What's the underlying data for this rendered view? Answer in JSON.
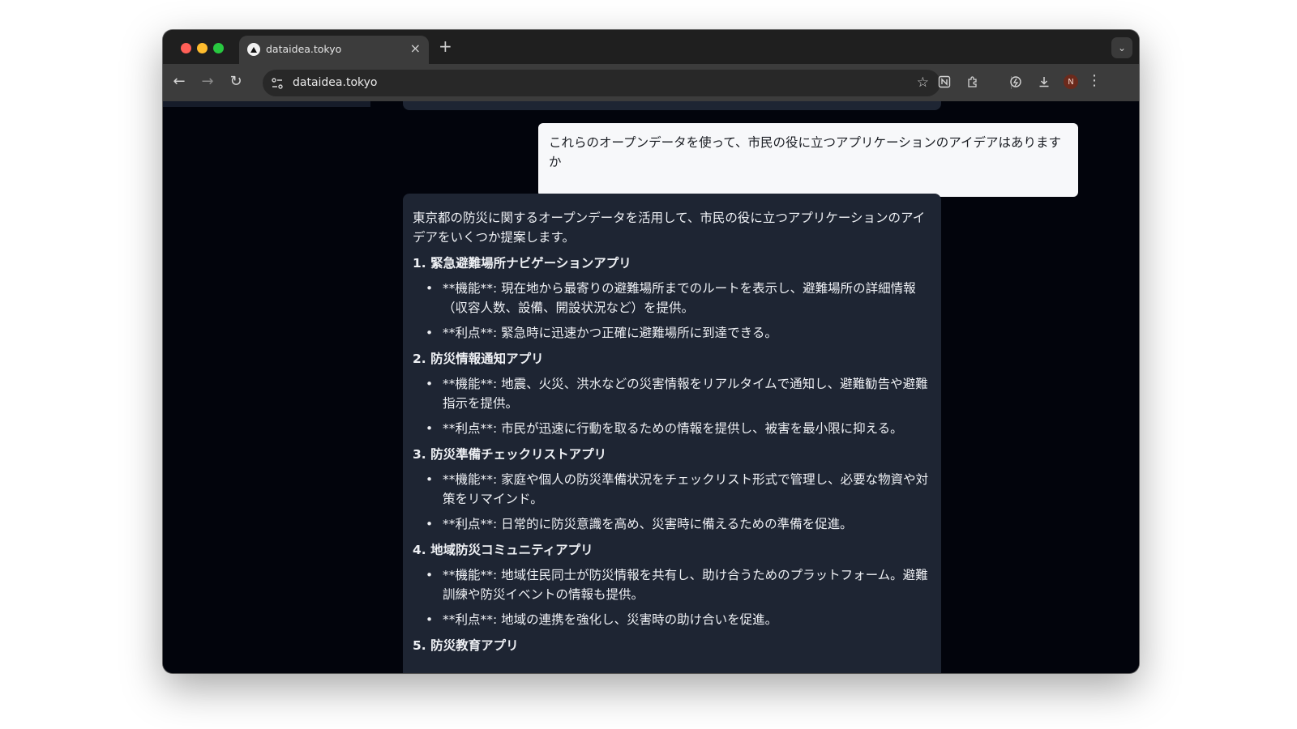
{
  "browser": {
    "tab_title": "dataidea.tokyo",
    "tab_close": "×",
    "new_tab": "+",
    "url": "dataidea.tokyo",
    "avatar_initial": "N"
  },
  "chat": {
    "user_message": "これらのオープンデータを使って、市民の役に立つアプリケーションのアイデアはありますか",
    "ai_intro": "東京都の防災に関するオープンデータを活用して、市民の役に立つアプリケーションのアイデアをいくつか提案します。",
    "ideas": [
      {
        "heading": "1. 緊急避難場所ナビゲーションアプリ",
        "bullets": [
          "**機能**: 現在地から最寄りの避難場所までのルートを表示し、避難場所の詳細情報（収容人数、設備、開設状況など）を提供。",
          "**利点**: 緊急時に迅速かつ正確に避難場所に到達できる。"
        ]
      },
      {
        "heading": "2. 防災情報通知アプリ",
        "bullets": [
          "**機能**: 地震、火災、洪水などの災害情報をリアルタイムで通知し、避難勧告や避難指示を提供。",
          "**利点**: 市民が迅速に行動を取るための情報を提供し、被害を最小限に抑える。"
        ]
      },
      {
        "heading": "3. 防災準備チェックリストアプリ",
        "bullets": [
          "**機能**: 家庭や個人の防災準備状況をチェックリスト形式で管理し、必要な物資や対策をリマインド。",
          "**利点**: 日常的に防災意識を高め、災害時に備えるための準備を促進。"
        ]
      },
      {
        "heading": "4. 地域防災コミュニティアプリ",
        "bullets": [
          "**機能**: 地域住民同士が防災情報を共有し、助け合うためのプラットフォーム。避難訓練や防災イベントの情報も提供。",
          "**利点**: 地域の連携を強化し、災害時の助け合いを促進。"
        ]
      },
      {
        "heading": "5. 防災教育アプリ",
        "bullets": []
      }
    ]
  }
}
